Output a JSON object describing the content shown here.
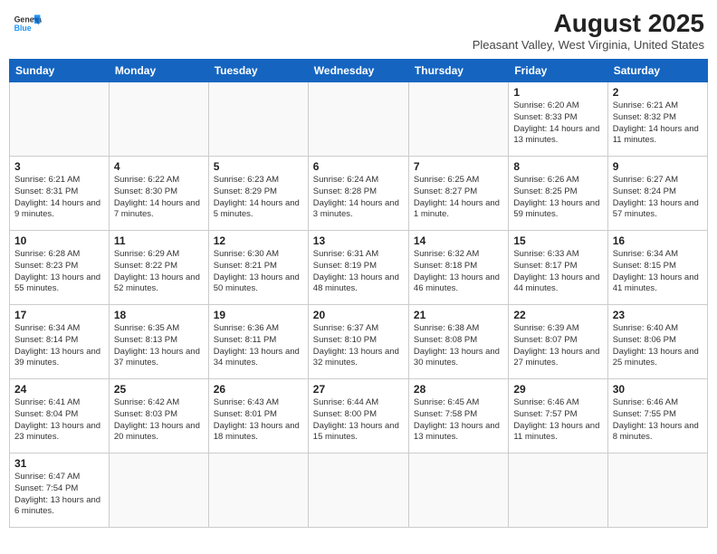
{
  "header": {
    "logo_line1": "General",
    "logo_line2": "Blue",
    "month_year": "August 2025",
    "location": "Pleasant Valley, West Virginia, United States"
  },
  "days_of_week": [
    "Sunday",
    "Monday",
    "Tuesday",
    "Wednesday",
    "Thursday",
    "Friday",
    "Saturday"
  ],
  "weeks": [
    [
      {
        "day": "",
        "info": ""
      },
      {
        "day": "",
        "info": ""
      },
      {
        "day": "",
        "info": ""
      },
      {
        "day": "",
        "info": ""
      },
      {
        "day": "",
        "info": ""
      },
      {
        "day": "1",
        "info": "Sunrise: 6:20 AM\nSunset: 8:33 PM\nDaylight: 14 hours and 13 minutes."
      },
      {
        "day": "2",
        "info": "Sunrise: 6:21 AM\nSunset: 8:32 PM\nDaylight: 14 hours and 11 minutes."
      }
    ],
    [
      {
        "day": "3",
        "info": "Sunrise: 6:21 AM\nSunset: 8:31 PM\nDaylight: 14 hours and 9 minutes."
      },
      {
        "day": "4",
        "info": "Sunrise: 6:22 AM\nSunset: 8:30 PM\nDaylight: 14 hours and 7 minutes."
      },
      {
        "day": "5",
        "info": "Sunrise: 6:23 AM\nSunset: 8:29 PM\nDaylight: 14 hours and 5 minutes."
      },
      {
        "day": "6",
        "info": "Sunrise: 6:24 AM\nSunset: 8:28 PM\nDaylight: 14 hours and 3 minutes."
      },
      {
        "day": "7",
        "info": "Sunrise: 6:25 AM\nSunset: 8:27 PM\nDaylight: 14 hours and 1 minute."
      },
      {
        "day": "8",
        "info": "Sunrise: 6:26 AM\nSunset: 8:25 PM\nDaylight: 13 hours and 59 minutes."
      },
      {
        "day": "9",
        "info": "Sunrise: 6:27 AM\nSunset: 8:24 PM\nDaylight: 13 hours and 57 minutes."
      }
    ],
    [
      {
        "day": "10",
        "info": "Sunrise: 6:28 AM\nSunset: 8:23 PM\nDaylight: 13 hours and 55 minutes."
      },
      {
        "day": "11",
        "info": "Sunrise: 6:29 AM\nSunset: 8:22 PM\nDaylight: 13 hours and 52 minutes."
      },
      {
        "day": "12",
        "info": "Sunrise: 6:30 AM\nSunset: 8:21 PM\nDaylight: 13 hours and 50 minutes."
      },
      {
        "day": "13",
        "info": "Sunrise: 6:31 AM\nSunset: 8:19 PM\nDaylight: 13 hours and 48 minutes."
      },
      {
        "day": "14",
        "info": "Sunrise: 6:32 AM\nSunset: 8:18 PM\nDaylight: 13 hours and 46 minutes."
      },
      {
        "day": "15",
        "info": "Sunrise: 6:33 AM\nSunset: 8:17 PM\nDaylight: 13 hours and 44 minutes."
      },
      {
        "day": "16",
        "info": "Sunrise: 6:34 AM\nSunset: 8:15 PM\nDaylight: 13 hours and 41 minutes."
      }
    ],
    [
      {
        "day": "17",
        "info": "Sunrise: 6:34 AM\nSunset: 8:14 PM\nDaylight: 13 hours and 39 minutes."
      },
      {
        "day": "18",
        "info": "Sunrise: 6:35 AM\nSunset: 8:13 PM\nDaylight: 13 hours and 37 minutes."
      },
      {
        "day": "19",
        "info": "Sunrise: 6:36 AM\nSunset: 8:11 PM\nDaylight: 13 hours and 34 minutes."
      },
      {
        "day": "20",
        "info": "Sunrise: 6:37 AM\nSunset: 8:10 PM\nDaylight: 13 hours and 32 minutes."
      },
      {
        "day": "21",
        "info": "Sunrise: 6:38 AM\nSunset: 8:08 PM\nDaylight: 13 hours and 30 minutes."
      },
      {
        "day": "22",
        "info": "Sunrise: 6:39 AM\nSunset: 8:07 PM\nDaylight: 13 hours and 27 minutes."
      },
      {
        "day": "23",
        "info": "Sunrise: 6:40 AM\nSunset: 8:06 PM\nDaylight: 13 hours and 25 minutes."
      }
    ],
    [
      {
        "day": "24",
        "info": "Sunrise: 6:41 AM\nSunset: 8:04 PM\nDaylight: 13 hours and 23 minutes."
      },
      {
        "day": "25",
        "info": "Sunrise: 6:42 AM\nSunset: 8:03 PM\nDaylight: 13 hours and 20 minutes."
      },
      {
        "day": "26",
        "info": "Sunrise: 6:43 AM\nSunset: 8:01 PM\nDaylight: 13 hours and 18 minutes."
      },
      {
        "day": "27",
        "info": "Sunrise: 6:44 AM\nSunset: 8:00 PM\nDaylight: 13 hours and 15 minutes."
      },
      {
        "day": "28",
        "info": "Sunrise: 6:45 AM\nSunset: 7:58 PM\nDaylight: 13 hours and 13 minutes."
      },
      {
        "day": "29",
        "info": "Sunrise: 6:46 AM\nSunset: 7:57 PM\nDaylight: 13 hours and 11 minutes."
      },
      {
        "day": "30",
        "info": "Sunrise: 6:46 AM\nSunset: 7:55 PM\nDaylight: 13 hours and 8 minutes."
      }
    ],
    [
      {
        "day": "31",
        "info": "Sunrise: 6:47 AM\nSunset: 7:54 PM\nDaylight: 13 hours and 6 minutes."
      },
      {
        "day": "",
        "info": ""
      },
      {
        "day": "",
        "info": ""
      },
      {
        "day": "",
        "info": ""
      },
      {
        "day": "",
        "info": ""
      },
      {
        "day": "",
        "info": ""
      },
      {
        "day": "",
        "info": ""
      }
    ]
  ]
}
